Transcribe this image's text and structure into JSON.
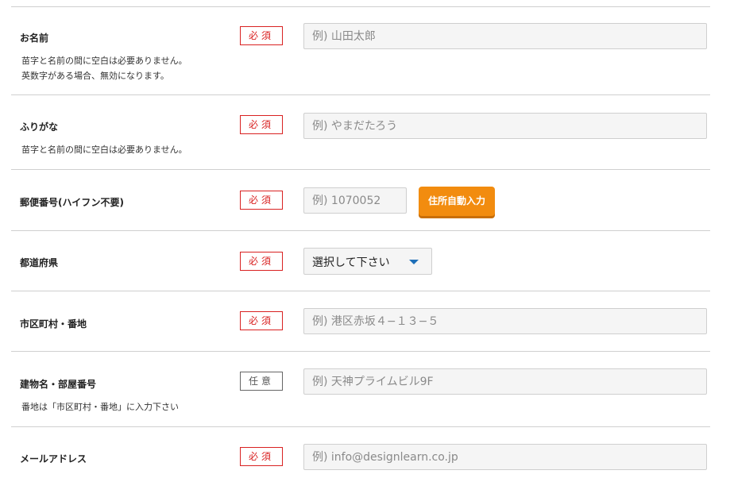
{
  "badges": {
    "required": "必須",
    "optional": "任意"
  },
  "fields": {
    "name": {
      "label": "お名前",
      "notes": [
        "苗字と名前の間に空白は必要ありません。",
        "英数字がある場合、無効になります。"
      ],
      "placeholder": "例) 山田太郎"
    },
    "furigana": {
      "label": "ふりがな",
      "notes": [
        "苗字と名前の間に空白は必要ありません。"
      ],
      "placeholder": "例) やまだたろう"
    },
    "postal_code": {
      "label": "郵便番号(ハイフン不要)",
      "placeholder": "例) 1070052",
      "button_label": "住所自動入力"
    },
    "prefecture": {
      "label": "都道府県",
      "selected": "選択して下さい"
    },
    "city": {
      "label": "市区町村・番地",
      "placeholder": "例) 港区赤坂４−１３−５"
    },
    "building": {
      "label": "建物名・部屋番号",
      "notes": [
        "番地は「市区町村・番地」に入力下さい"
      ],
      "placeholder": "例) 天神プライムビル9F"
    },
    "email": {
      "label": "メールアドレス",
      "placeholder": "例) info@designlearn.co.jp"
    }
  },
  "colors": {
    "required_red": "#d92121",
    "button_orange": "#f28c0f",
    "caret_blue": "#1e6fb8"
  }
}
